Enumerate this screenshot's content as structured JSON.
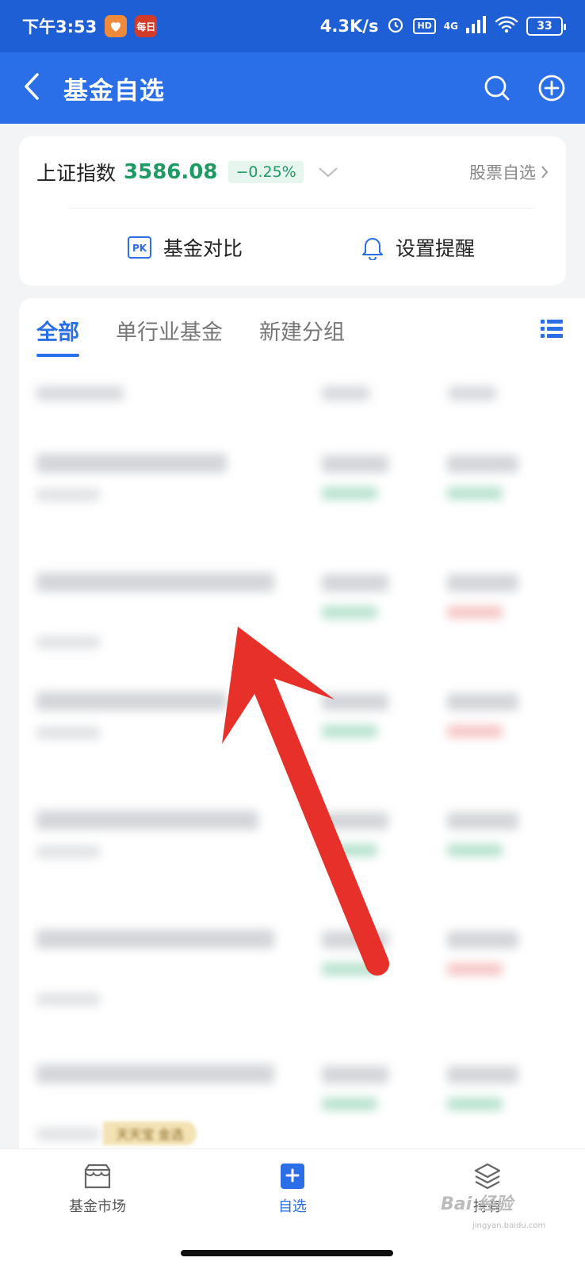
{
  "status_bar": {
    "time": "下午3:53",
    "app_badge": "每日",
    "network_speed": "4.3K/s",
    "hd": "HD",
    "signal": "4G",
    "battery": "33"
  },
  "header": {
    "title": "基金自选"
  },
  "index_card": {
    "name": "上证指数",
    "value": "3586.08",
    "change": "−0.25%",
    "stock_link": "股票自选",
    "actions": [
      {
        "label": "基金对比",
        "icon": "pk-icon"
      },
      {
        "label": "设置提醒",
        "icon": "bell-icon"
      }
    ]
  },
  "tabs": [
    {
      "label": "全部",
      "active": true
    },
    {
      "label": "单行业基金",
      "active": false
    },
    {
      "label": "新建分组",
      "active": false
    }
  ],
  "promo_tag": "天天宝 金选",
  "bottom_nav": [
    {
      "label": "基金市场",
      "icon": "market-icon",
      "active": false
    },
    {
      "label": "自选",
      "icon": "watchlist-icon",
      "active": true
    },
    {
      "label": "持有",
      "icon": "holdings-icon",
      "active": false
    }
  ],
  "watermark": {
    "text": "Bai 经验",
    "sub": "jingyan.baidu.com"
  },
  "colors": {
    "brand_blue": "#2a6ee8",
    "up_green": "#1e9a63",
    "arrow_red": "#e8302a"
  }
}
